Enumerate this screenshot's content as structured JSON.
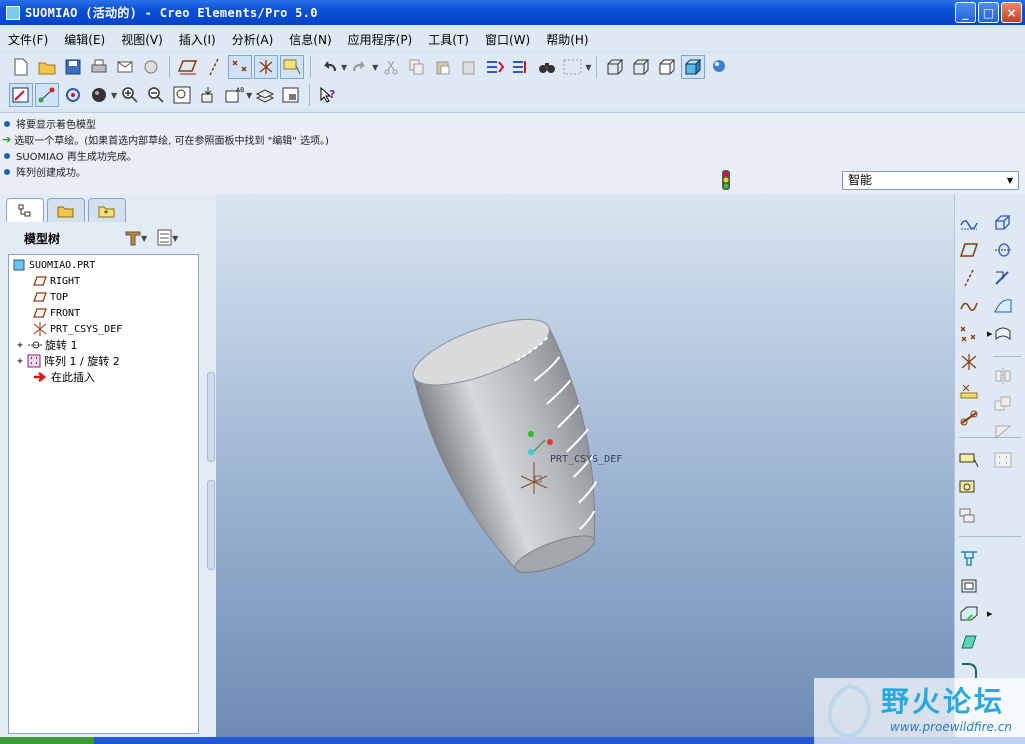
{
  "window": {
    "title": "SUOMIAO (活动的) - Creo Elements/Pro 5.0",
    "minimize_label": "_",
    "maximize_label": "□",
    "close_label": "×"
  },
  "menu": [
    "文件(F)",
    "编辑(E)",
    "视图(V)",
    "插入(I)",
    "分析(A)",
    "信息(N)",
    "应用程序(P)",
    "工具(T)",
    "窗口(W)",
    "帮助(H)"
  ],
  "messages": [
    {
      "bullet": "dot",
      "text": "将要显示着色模型"
    },
    {
      "bullet": "arrow",
      "text": "选取一个草绘。(如果首选内部草绘, 可在参照面板中找到 \"编辑\" 选项。)"
    },
    {
      "bullet": "dot",
      "text": "SUOMIAO 再生成功完成。"
    },
    {
      "bullet": "dot",
      "text": "阵列创建成功。"
    }
  ],
  "filter": {
    "value": "智能"
  },
  "model_tree": {
    "title": "模型树",
    "items": [
      {
        "label": "SUOMIAO.PRT",
        "icon": "part-icon"
      },
      {
        "label": "RIGHT",
        "icon": "datum-plane-icon"
      },
      {
        "label": "TOP",
        "icon": "datum-plane-icon"
      },
      {
        "label": "FRONT",
        "icon": "datum-plane-icon"
      },
      {
        "label": "PRT_CSYS_DEF",
        "icon": "csys-icon"
      },
      {
        "label": "旋转 1",
        "icon": "revolve-icon",
        "expandable": true
      },
      {
        "label": "阵列 1 / 旋转 2",
        "icon": "pattern-icon",
        "expandable": true
      },
      {
        "label": "在此插入",
        "icon": "insert-here-arrow-icon"
      }
    ]
  },
  "viewport": {
    "csys_label": "PRT_CSYS_DEF"
  },
  "watermark": {
    "text": "野火论坛",
    "url": "www.proewildfire.cn"
  },
  "colors": {
    "title_bar": "#0a4fd6",
    "viewport_top": "#dbe6f0",
    "viewport_bottom": "#6d8bb3",
    "model": "#b9bcbf"
  }
}
